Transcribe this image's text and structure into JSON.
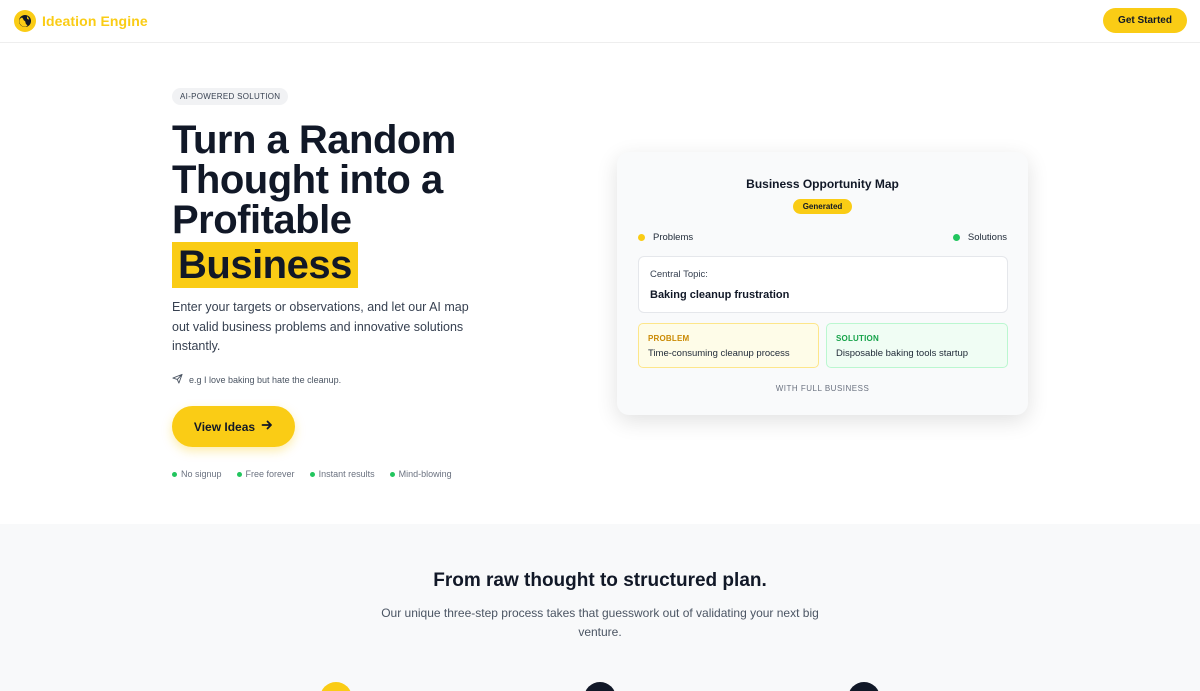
{
  "header": {
    "brand_name": "Ideation Engine",
    "logo_icon": "globe-icon",
    "cta_label": "Get Started"
  },
  "hero": {
    "badge": "AI-POWERED SOLUTION",
    "title_line1": "Turn a Random",
    "title_line2": "Thought into a",
    "title_line3": "Profitable",
    "title_highlight": "Business",
    "subtitle": "Enter your targets or observations, and let our AI map out valid business problems and innovative solutions instantly.",
    "example_icon": "paper-plane-icon",
    "example_text": "e.g I love baking but hate the cleanup.",
    "cta_label": "View Ideas",
    "cta_icon": "arrow-right-icon",
    "features": [
      "No signup",
      "Free forever",
      "Instant results",
      "Mind-blowing"
    ]
  },
  "card": {
    "title": "Business Opportunity Map",
    "status_badge": "Generated",
    "legend_problems": "Problems",
    "legend_solutions": "Solutions",
    "central_label": "Central Topic:",
    "central_value": "Baking cleanup frustration",
    "problem_tag": "PROBLEM",
    "problem_text": "Time-consuming cleanup process",
    "solution_tag": "SOLUTION",
    "solution_text": "Disposable baking tools startup",
    "footer": "WITH FULL BUSINESS"
  },
  "section2": {
    "title": "From raw thought to structured plan.",
    "subtitle": "Our unique three-step process takes that guesswork out of validating your next big venture."
  },
  "colors": {
    "accent": "#facc15",
    "success": "#22c55e",
    "dark": "#111827"
  }
}
